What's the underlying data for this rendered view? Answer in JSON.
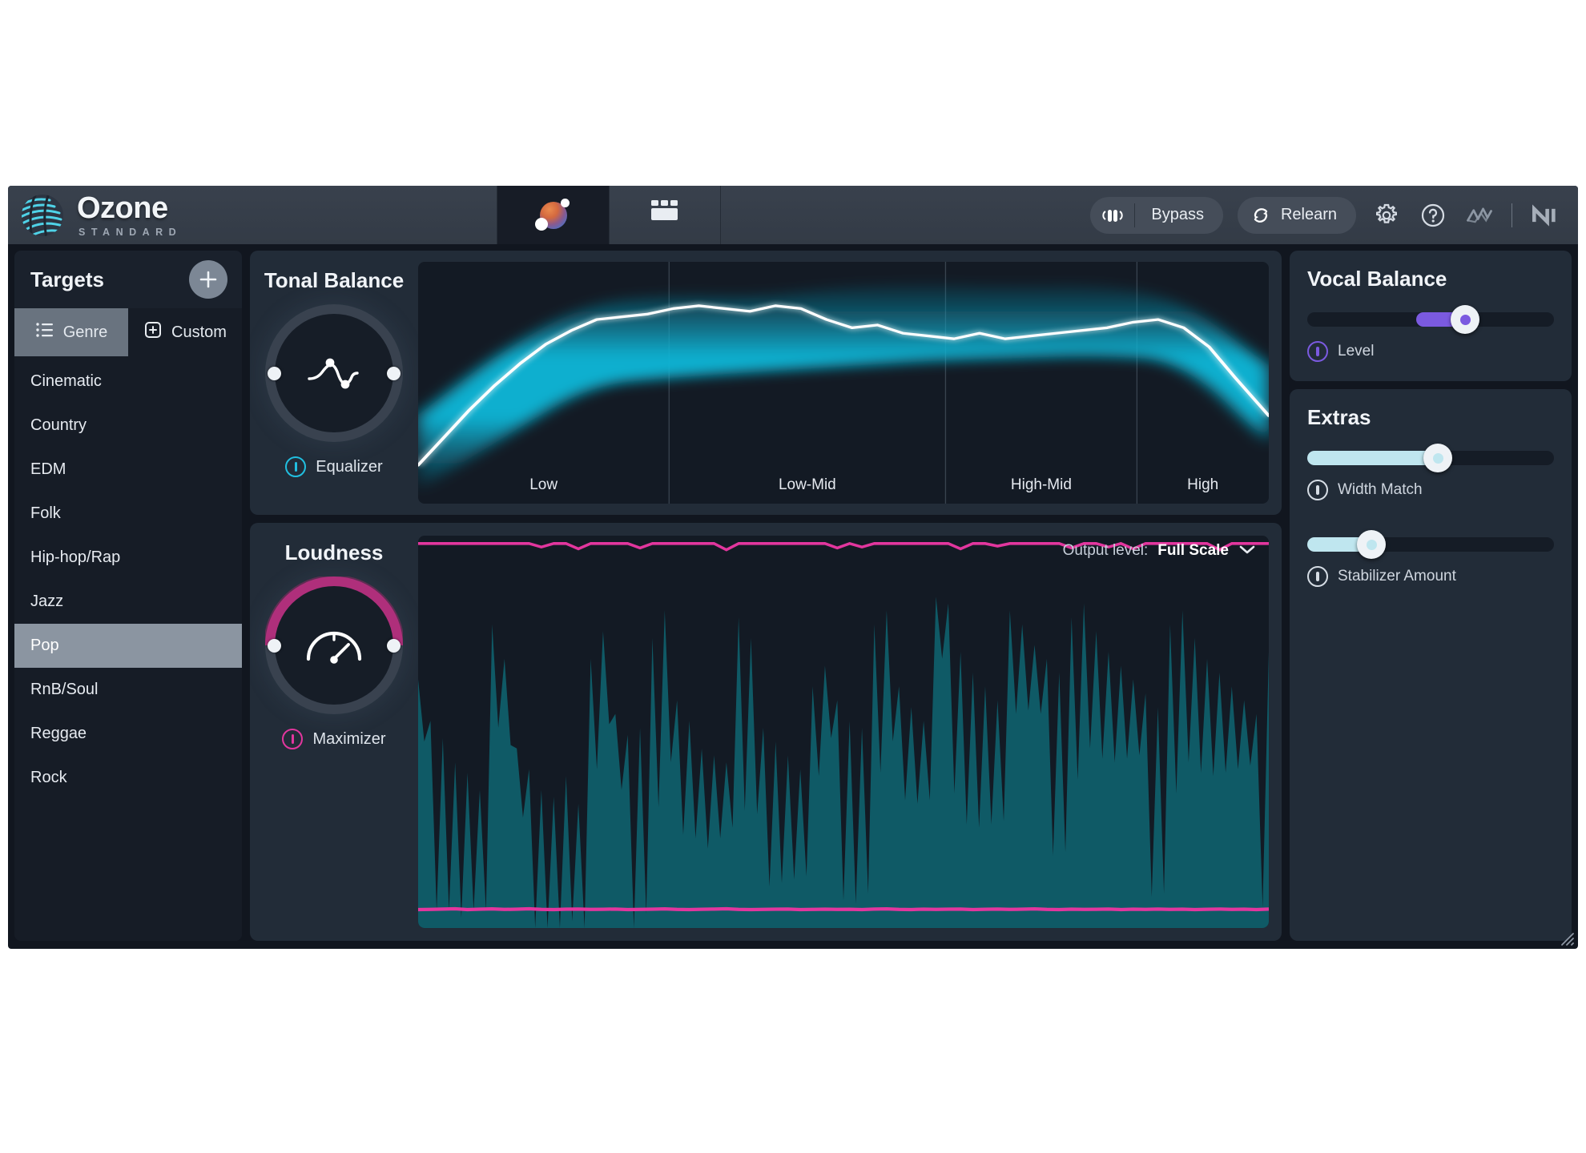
{
  "app": {
    "name": "Ozone",
    "edition": "STANDARD",
    "logo_icon": "ozone-sphere-icon"
  },
  "header": {
    "tabs": [
      {
        "id": "assistant",
        "icon": "assistant-orb-icon",
        "active": true
      },
      {
        "id": "modules",
        "icon": "modules-window-icon",
        "active": false
      }
    ],
    "bypass": {
      "label": "Bypass",
      "icon": "speaker-bypass-icon"
    },
    "relearn": {
      "label": "Relearn",
      "icon": "refresh-circle-icon"
    },
    "icons": [
      {
        "name": "gear-icon"
      },
      {
        "name": "help-icon"
      },
      {
        "name": "izotope-logo-icon"
      },
      {
        "name": "native-instruments-logo-icon"
      }
    ]
  },
  "sidebar": {
    "title": "Targets",
    "add_label": "+",
    "tabs": [
      {
        "label": "Genre",
        "icon": "list-icon",
        "active": true
      },
      {
        "label": "Custom",
        "icon": "document-add-icon",
        "active": false
      }
    ],
    "genres": [
      {
        "label": "Cinematic",
        "selected": false
      },
      {
        "label": "Country",
        "selected": false
      },
      {
        "label": "EDM",
        "selected": false
      },
      {
        "label": "Folk",
        "selected": false
      },
      {
        "label": "Hip-hop/Rap",
        "selected": false
      },
      {
        "label": "Jazz",
        "selected": false
      },
      {
        "label": "Pop",
        "selected": true
      },
      {
        "label": "RnB/Soul",
        "selected": false
      },
      {
        "label": "Reggae",
        "selected": false
      },
      {
        "label": "Rock",
        "selected": false
      }
    ]
  },
  "tonal_balance": {
    "title": "Tonal Balance",
    "module_label": "Equalizer",
    "module_color": "#21bfe0",
    "knob_icon": "eq-curve-icon",
    "bands": [
      "Low",
      "Low-Mid",
      "High-Mid",
      "High"
    ]
  },
  "loudness": {
    "title": "Loudness",
    "module_label": "Maximizer",
    "module_color": "#e2369e",
    "knob_icon": "gauge-icon",
    "output_level_label": "Output level:",
    "output_level_value": "Full Scale",
    "dropdown_icon": "chevron-down-icon"
  },
  "vocal_balance": {
    "title": "Vocal Balance",
    "slider": {
      "label": "Level",
      "value_pct": 64,
      "fill_from_pct": 44,
      "accent": "#7b5ae0"
    }
  },
  "extras": {
    "title": "Extras",
    "sliders": [
      {
        "label": "Width Match",
        "value_pct": 53,
        "accent": "#bfe6ef"
      },
      {
        "label": "Stabilizer Amount",
        "value_pct": 26,
        "accent": "#bfe6ef"
      }
    ]
  },
  "chart_data": [
    {
      "type": "area",
      "title": "Tonal Balance",
      "xlabel": "",
      "ylabel": "",
      "grid": true,
      "legend": "none",
      "categories": [
        "Low",
        "Low-Mid",
        "High-Mid",
        "High"
      ],
      "series": [
        {
          "name": "Current spectrum",
          "color": "#ffffff",
          "x": [
            0,
            3,
            6,
            9,
            12,
            15,
            18,
            21,
            24,
            27,
            30,
            33,
            36,
            39,
            42,
            45,
            48,
            51,
            54,
            57,
            60,
            63,
            66,
            69,
            72,
            75,
            78,
            81,
            84,
            87,
            90,
            93,
            96,
            100
          ],
          "values": [
            4,
            14,
            24,
            33,
            41,
            48,
            53,
            57,
            58,
            59,
            61,
            62,
            61,
            60,
            62,
            61,
            57,
            54,
            55,
            52,
            51,
            50,
            52,
            50,
            51,
            52,
            53,
            54,
            56,
            57,
            54,
            47,
            36,
            22
          ]
        },
        {
          "name": "Target range (upper)",
          "color": "#19a8c8",
          "x": [
            0,
            10,
            20,
            30,
            40,
            50,
            60,
            70,
            80,
            90,
            100
          ],
          "values": [
            22,
            46,
            63,
            66,
            65,
            69,
            70,
            69,
            70,
            64,
            40
          ]
        },
        {
          "name": "Target range (lower)",
          "color": "#19a8c8",
          "x": [
            0,
            10,
            20,
            30,
            40,
            50,
            60,
            70,
            80,
            90,
            100
          ],
          "values": [
            -5,
            14,
            33,
            36,
            38,
            40,
            42,
            43,
            44,
            42,
            12
          ]
        }
      ]
    },
    {
      "type": "area",
      "title": "Loudness",
      "xlabel": "",
      "ylabel": "",
      "grid": false,
      "legend": "none",
      "series": [
        {
          "name": "Waveform",
          "color": "#11616d",
          "values": [
            72,
            60,
            55,
            48,
            45,
            40,
            88,
            78,
            52,
            46,
            40,
            38,
            44,
            36,
            78,
            86,
            62,
            56,
            58,
            84,
            92,
            66,
            60,
            52,
            50,
            48,
            90,
            84,
            58,
            54,
            50,
            46,
            70,
            76,
            66,
            60,
            58,
            88,
            92,
            70,
            64,
            60,
            96,
            94,
            80,
            74,
            70,
            66,
            92,
            88,
            82,
            78,
            74,
            90,
            94,
            86,
            80,
            76,
            72,
            68,
            64,
            88,
            92,
            84,
            78,
            74,
            70,
            66,
            62,
            80
          ]
        },
        {
          "name": "Ceiling",
          "color": "#e2369e",
          "values": [
            100,
            100,
            100,
            100,
            100,
            100,
            100,
            100,
            100,
            100,
            92,
            100,
            100,
            88,
            100,
            100,
            100,
            100,
            90,
            100,
            100,
            100,
            100,
            100,
            100,
            86,
            100,
            100,
            100,
            100,
            100,
            100,
            100,
            100,
            90,
            100,
            92,
            100,
            100,
            100,
            100,
            100,
            100,
            100,
            88,
            100,
            100,
            94,
            100,
            100,
            100,
            100,
            100,
            90,
            100,
            100,
            92,
            100,
            88,
            100,
            100,
            100,
            100,
            100,
            100,
            86,
            100,
            100,
            100,
            100
          ]
        },
        {
          "name": "Gain reduction",
          "color": "#e2369e",
          "values": [
            2,
            4,
            8,
            12,
            2,
            6,
            10,
            3,
            7,
            11,
            4,
            2,
            6,
            9,
            3,
            5,
            8,
            2,
            4,
            7,
            10,
            3,
            2,
            5,
            8,
            11,
            4,
            2,
            3,
            6,
            9,
            2,
            4,
            7,
            3,
            5,
            2,
            8,
            10,
            4,
            2,
            6,
            3,
            7,
            9,
            2,
            5,
            8,
            3,
            6,
            10,
            4,
            2,
            7,
            3,
            5,
            9,
            2,
            6,
            4,
            8,
            3,
            7,
            2,
            5,
            9,
            4,
            6,
            2,
            8
          ]
        }
      ]
    }
  ]
}
